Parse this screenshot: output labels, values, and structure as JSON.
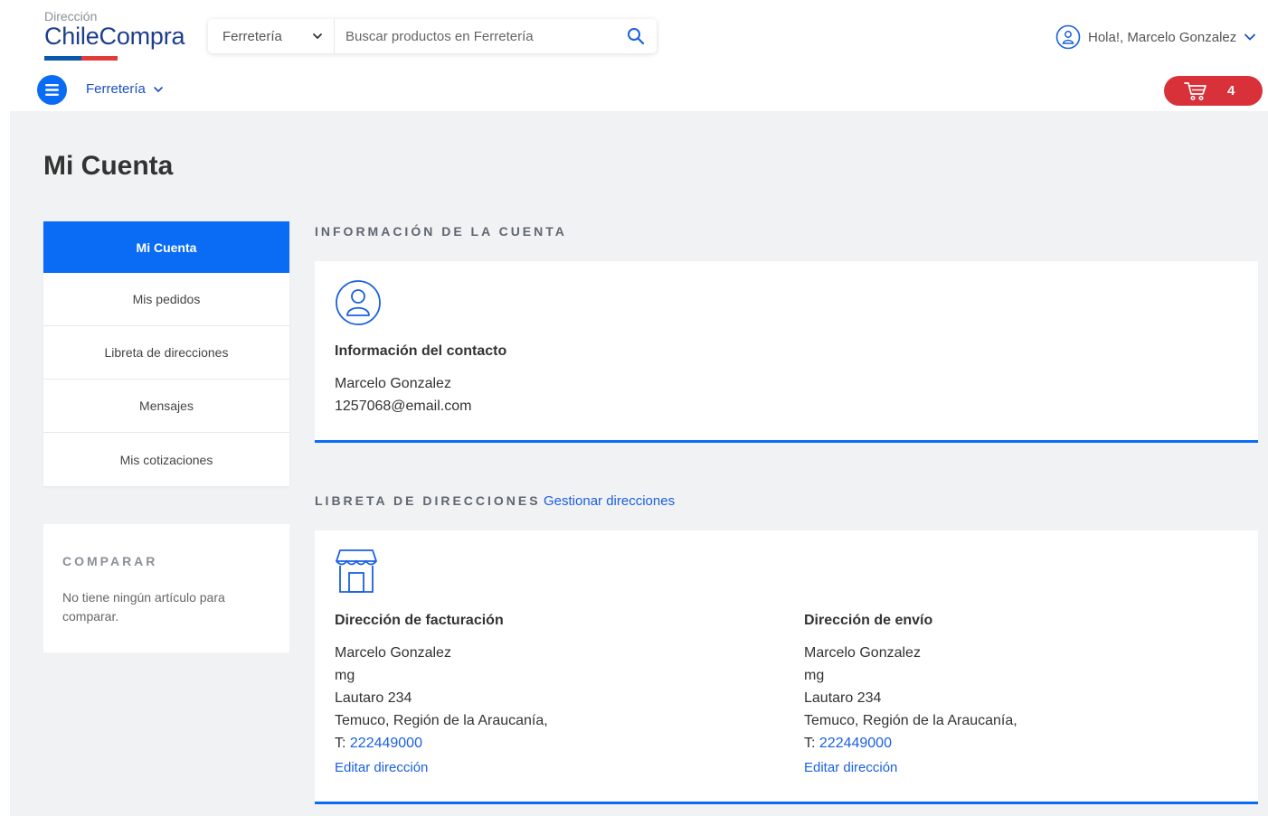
{
  "header": {
    "logo_small": "Dirección",
    "logo_big": "ChileCompra",
    "search": {
      "category": "Ferretería",
      "placeholder": "Buscar productos en Ferretería"
    },
    "user_greeting": "Hola!, Marcelo Gonzalez",
    "category_nav": "Ferretería",
    "cart_count": "4"
  },
  "page": {
    "title": "Mi Cuenta"
  },
  "sidebar": {
    "items": [
      {
        "label": "Mi Cuenta"
      },
      {
        "label": "Mis pedidos"
      },
      {
        "label": "Libreta de direcciones"
      },
      {
        "label": "Mensajes"
      },
      {
        "label": "Mis cotizaciones"
      }
    ]
  },
  "compare": {
    "title": "COMPARAR",
    "text": "No tiene ningún artículo para comparar."
  },
  "account_info": {
    "section_title": "INFORMACIÓN DE LA CUENTA",
    "heading": "Información del contacto",
    "name": "Marcelo Gonzalez",
    "email": "1257068@email.com"
  },
  "address_book": {
    "section_title": "LIBRETA DE DIRECCIONES",
    "manage_link": "Gestionar direcciones",
    "billing": {
      "heading": "Dirección de facturación",
      "name": "Marcelo Gonzalez",
      "company": "mg",
      "street": "Lautaro 234",
      "city": "Temuco, Región de la Araucanía,",
      "phone_prefix": "T: ",
      "phone": "222449000",
      "edit": "Editar dirección"
    },
    "shipping": {
      "heading": "Dirección de envío",
      "name": "Marcelo Gonzalez",
      "company": "mg",
      "street": "Lautaro 234",
      "city": "Temuco, Región de la Araucanía,",
      "phone_prefix": "T: ",
      "phone": "222449000",
      "edit": "Editar dirección"
    }
  },
  "colors": {
    "primary": "#0a6cf5",
    "cart": "#d9313a",
    "brand": "#1e3e8c",
    "link": "#1a60e0"
  },
  "icons": {
    "search": "search-icon",
    "user": "user-circle-icon",
    "menu": "hamburger-menu-icon",
    "cart": "cart-icon",
    "contact": "contact-user-icon",
    "store": "store-icon"
  }
}
